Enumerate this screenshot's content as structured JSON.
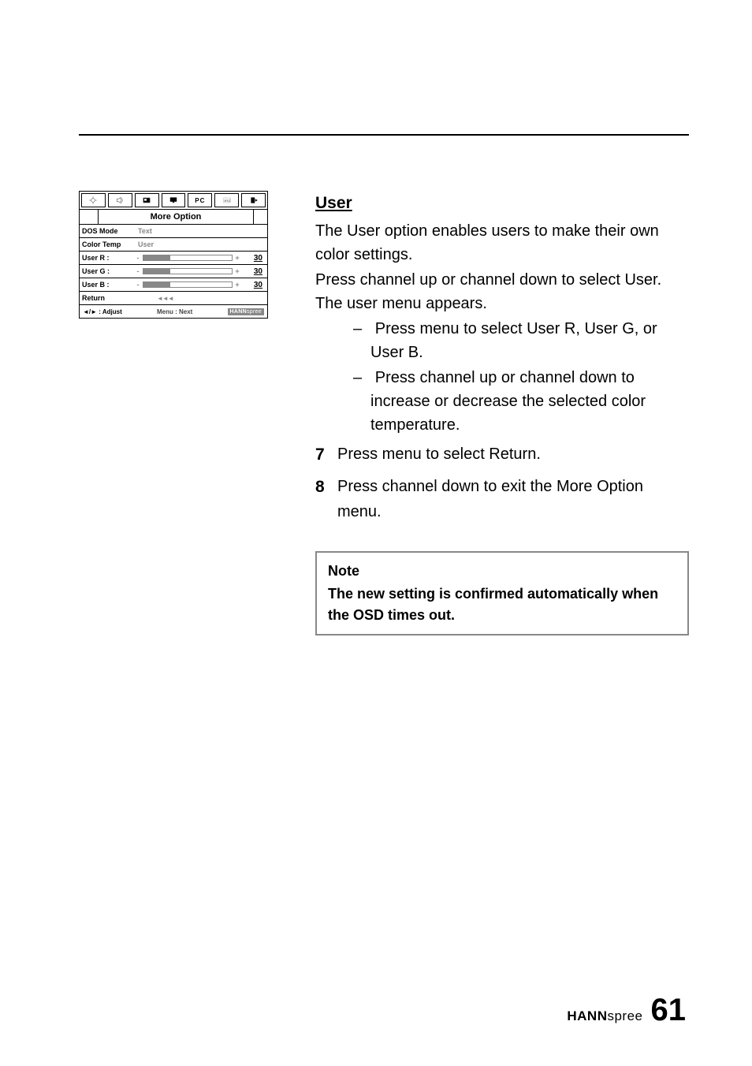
{
  "osd": {
    "title": "More Option",
    "tabs": {
      "pc": "PC"
    },
    "rows": {
      "dos": {
        "label": "DOS Mode",
        "value": "Text"
      },
      "colortemp": {
        "label": "Color Temp",
        "value": "User"
      },
      "userR": {
        "label": "User R :",
        "value": "30"
      },
      "userG": {
        "label": "User G :",
        "value": "30"
      },
      "userB": {
        "label": "User B :",
        "value": "30"
      },
      "return": {
        "label": "Return"
      }
    },
    "footer": {
      "left": "◄/► : Adjust",
      "center": "Menu  :  Next",
      "right_brand_a": "HANN",
      "right_brand_b": "spree"
    }
  },
  "content": {
    "title": "User",
    "p1": "The User option enables users to make their own color settings.",
    "p2": "Press channel up or channel down to select User. The user menu appears.",
    "dash1": "Press menu to select User R, User G, or User B.",
    "dash2": "Press channel up or channel down to increase or decrease the selected color temperature.",
    "step7_num": "7",
    "step7": "Press menu to select Return.",
    "step8_num": "8",
    "step8": "Press channel down to exit the More Option menu."
  },
  "note": {
    "title": "Note",
    "body": "The new setting is confirmed automatically when the OSD times out."
  },
  "footer": {
    "brand_a": "HANN",
    "brand_b": "spree",
    "page": "61"
  }
}
